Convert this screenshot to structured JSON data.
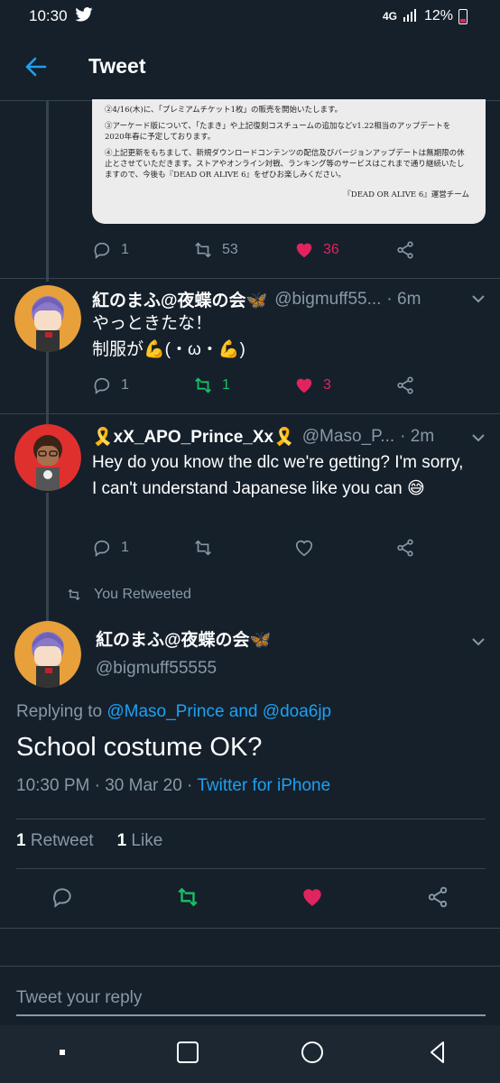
{
  "status_bar": {
    "time": "10:30",
    "network": "4G",
    "battery": "12%"
  },
  "header": {
    "title": "Tweet"
  },
  "image_card": {
    "lines": [
      "②4/16(木)に、「プレミアムチケット1枚」の販売を開始いたします。",
      "③アーケード版について、「たまき」や上記復刻コスチュームの追加などv1.22相当のアップデートを2020年春に予定しております。",
      "④上記更新をもちまして、新規ダウンロードコンテンツの配信及びバージョンアップデートは無期限の休止とさせていただきます。ストアやオンライン対戦、ランキング等のサービスはこれまで通り継続いたしますので、今後も『DEAD OR ALIVE 6』をぜひお楽しみください。"
    ],
    "signature": "『DEAD OR ALIVE 6』運営チーム"
  },
  "tweet1_actions": {
    "replies": "1",
    "retweets": "53",
    "likes": "36"
  },
  "tweet2": {
    "name": "紅のまふ@夜蝶の会🦋",
    "handle": "@bigmuff55...",
    "time": "· 6m",
    "line1": "やっときたな！",
    "line2": "制服が💪(・ω・💪)",
    "replies": "1",
    "retweets": "1",
    "likes": "3"
  },
  "tweet3": {
    "name": "🎗️xX_APO_Prince_Xx🎗️",
    "handle": "@Maso_P...",
    "time": "· 2m",
    "text": "Hey do you know the dlc we're getting? I'm sorry, I can't understand Japanese like you can 😅",
    "replies": "1"
  },
  "retweet_label": "You Retweeted",
  "main_tweet": {
    "name": "紅のまふ@夜蝶の会🦋",
    "handle": "@bigmuff55555",
    "replying_prefix": "Replying to",
    "reply_user1": "@Maso_Prince",
    "reply_and": "and",
    "reply_user2": "@doa6jp",
    "text": "School costume OK?",
    "timestamp": "10:30 PM · 30 Mar 20 ·",
    "source": "Twitter for iPhone",
    "retweet_count": "1",
    "retweet_label": "Retweet",
    "like_count": "1",
    "like_label": "Like"
  },
  "reply_box": {
    "placeholder": "Tweet your reply"
  },
  "colors": {
    "background": "#15202b",
    "accent": "#1da1f2",
    "like": "#e0245e",
    "retweet": "#17bf63",
    "muted": "#8899a6"
  }
}
